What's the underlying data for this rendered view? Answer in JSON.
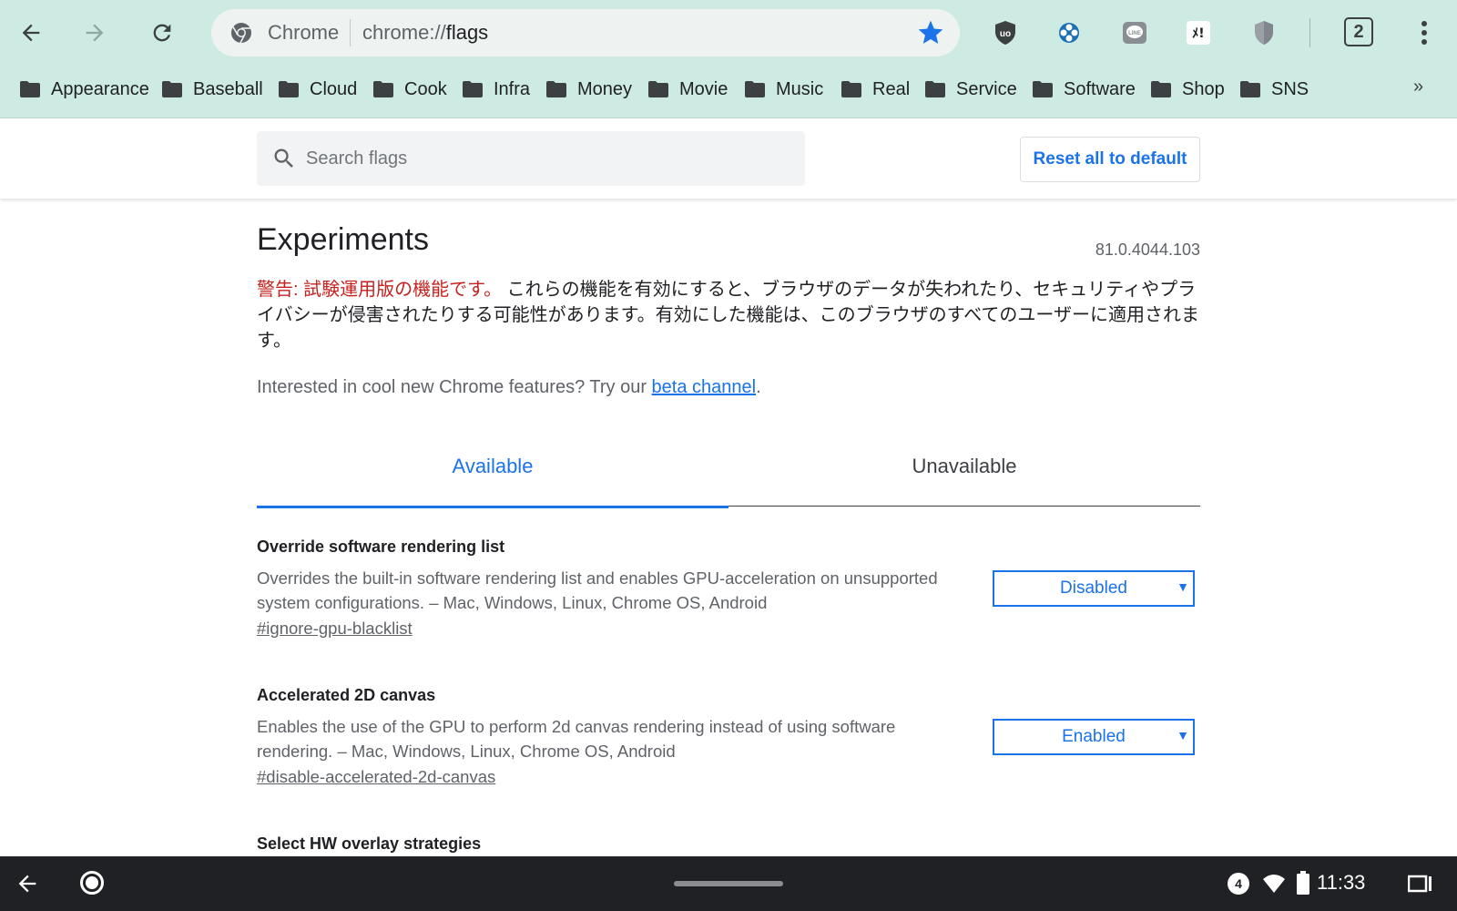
{
  "omnibox": {
    "site_label": "Chrome",
    "url_prefix": "chrome://",
    "url_path": "flags"
  },
  "toolbar": {
    "extensions": [
      {
        "name": "ublock-icon",
        "label": "uo"
      },
      {
        "name": "extension-blue-icon",
        "label": ""
      },
      {
        "name": "line-icon",
        "label": "LINE"
      },
      {
        "name": "mail-extension-icon",
        "label": "ﾒ!"
      },
      {
        "name": "shield-icon",
        "label": ""
      }
    ],
    "tab_count": "2"
  },
  "bookmarks": [
    "Appearance",
    "Baseball",
    "Cloud",
    "Cook",
    "Infra",
    "Money",
    "Movie",
    "Music",
    "Real",
    "Service",
    "Software",
    "Shop",
    "SNS"
  ],
  "bookmarks_more": "»",
  "header": {
    "search_placeholder": "Search flags",
    "reset_label": "Reset all to default"
  },
  "page": {
    "title": "Experiments",
    "version": "81.0.4044.103",
    "warning_prefix": "警告: 試験運用版の機能です。",
    "warning_text": " これらの機能を有効にすると、ブラウザのデータが失われたり、セキュリティやプライバシーが侵害されたりする可能性があります。有効にした機能は、このブラウザのすべてのユーザーに適用されます。",
    "beta_prefix": "Interested in cool new Chrome features? Try our ",
    "beta_link": "beta channel",
    "beta_suffix": "."
  },
  "tabs": {
    "available": "Available",
    "unavailable": "Unavailable"
  },
  "flags": [
    {
      "name": "Override software rendering list",
      "description": "Overrides the built-in software rendering list and enables GPU-acceleration on unsupported system configurations. – Mac, Windows, Linux, Chrome OS, Android",
      "link": "#ignore-gpu-blacklist",
      "value": "Disabled"
    },
    {
      "name": "Accelerated 2D canvas",
      "description": "Enables the use of the GPU to perform 2d canvas rendering instead of using software rendering. – Mac, Windows, Linux, Chrome OS, Android",
      "link": "#disable-accelerated-2d-canvas",
      "value": "Enabled"
    },
    {
      "name": "Select HW overlay strategies"
    }
  ],
  "shelf": {
    "notification_count": "4",
    "time": "11:33"
  },
  "colors": {
    "toolbar_bg": "#cdebe2",
    "accent": "#1a73e8",
    "warning": "#c5221f",
    "shelf_bg": "#202124"
  }
}
